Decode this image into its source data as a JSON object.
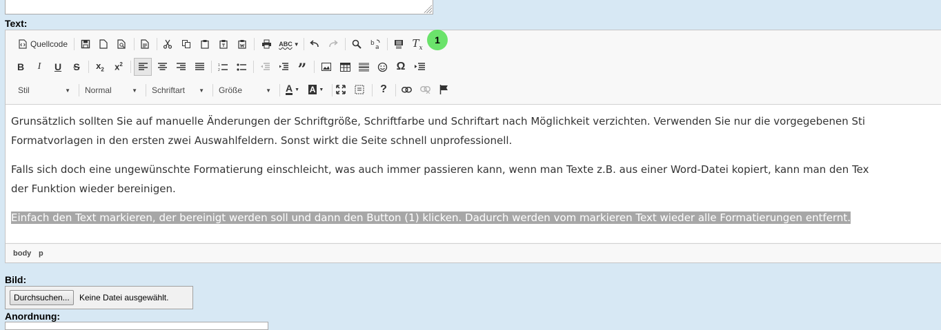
{
  "labels": {
    "text": "Text:",
    "bild": "Bild:",
    "anordnung": "Anordnung:"
  },
  "toolbar": {
    "source_label": "Quellcode",
    "style_combo": "Stil",
    "format_combo": "Normal",
    "font_combo": "Schriftart",
    "size_combo": "Größe",
    "spellcheck_label": "ABC"
  },
  "badge": {
    "number": "1",
    "color": "#6be36b"
  },
  "content": {
    "paragraphs": [
      {
        "lines": [
          "Grunsätzlich sollten Sie auf manuelle Änderungen der Schriftgröße, Schriftfarbe und Schriftart nach Möglichkeit verzichten. Verwenden Sie nur die vorgegebenen Sti",
          "Formatvorlagen in den ersten zwei Auswahlfeldern. Sonst wirkt die Seite schnell unprofessionell."
        ]
      },
      {
        "lines": [
          "Falls sich doch eine ungewünschte Formatierung einschleicht, was auch immer passieren kann, wenn man Texte z.B. aus einer Word-Datei kopiert, kann man den Tex",
          "der Funktion wieder bereinigen."
        ]
      },
      {
        "lines": [
          "Einfach den Text markieren, der bereinigt werden soll und dann den Button (1) klicken. Dadurch werden vom markieren Text wieder alle Formatierungen entfernt."
        ],
        "selected": true
      }
    ]
  },
  "elements_path": [
    "body",
    "p"
  ],
  "file_input": {
    "button_label": "Durchsuchen...",
    "status": "Keine Datei ausgewählt."
  },
  "colors": {
    "page_bg": "#d7e8f4",
    "selection_bg": "#a7a7a7",
    "badge_green": "#6be36b"
  }
}
